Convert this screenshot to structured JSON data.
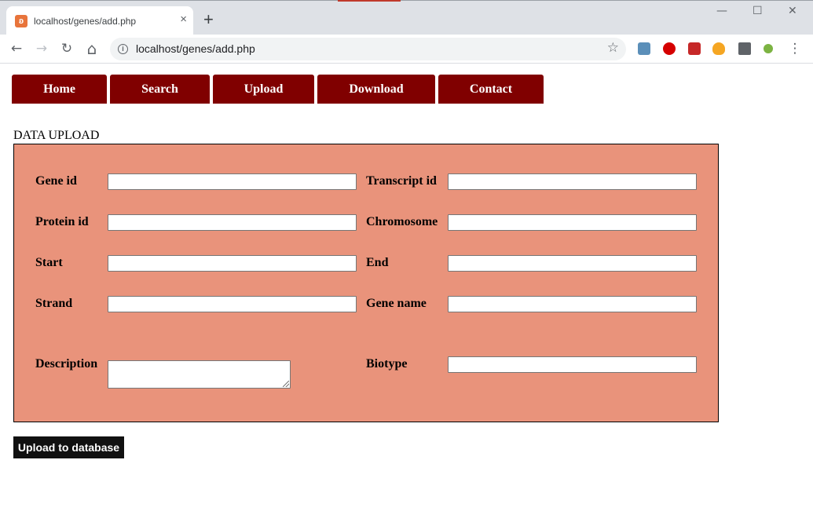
{
  "browser": {
    "tab_title": "localhost/genes/add.php",
    "url": "localhost/genes/add.php",
    "close_glyph": "×",
    "new_tab_glyph": "+",
    "minimize_glyph": "—",
    "maximize_glyph": "☐",
    "window_close_glyph": "✕",
    "back_glyph": "←",
    "forward_glyph": "→",
    "reload_glyph": "↻",
    "home_glyph": "⌂",
    "info_glyph": "i",
    "star_glyph": "☆",
    "menu_glyph": "⋮",
    "accent_color": "#e8743b"
  },
  "nav": {
    "items": [
      {
        "label": "Home"
      },
      {
        "label": "Search"
      },
      {
        "label": "Upload"
      },
      {
        "label": "Download"
      },
      {
        "label": "Contact"
      }
    ],
    "color": "#800000"
  },
  "form": {
    "title": "DATA UPLOAD",
    "panel_color": "#e9937b",
    "fields": {
      "gene_id": {
        "label": "Gene id",
        "value": ""
      },
      "transcript_id": {
        "label": "Transcript id",
        "value": ""
      },
      "protein_id": {
        "label": "Protein id",
        "value": ""
      },
      "chromosome": {
        "label": "Chromosome",
        "value": ""
      },
      "start": {
        "label": "Start",
        "value": ""
      },
      "end": {
        "label": "End",
        "value": ""
      },
      "strand": {
        "label": "Strand",
        "value": ""
      },
      "gene_name": {
        "label": "Gene name",
        "value": ""
      },
      "description": {
        "label": "Description",
        "value": ""
      },
      "biotype": {
        "label": "Biotype",
        "value": ""
      }
    },
    "submit_label": "Upload to database"
  }
}
